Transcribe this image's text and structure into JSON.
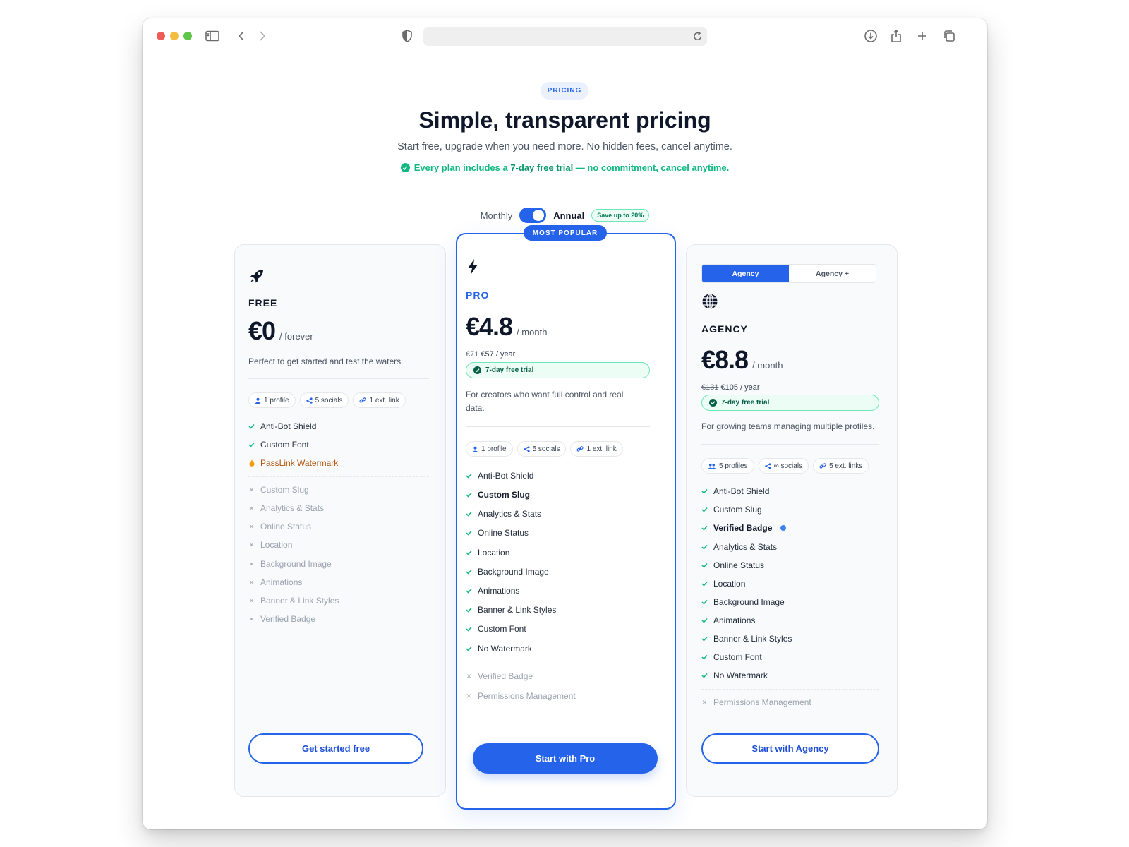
{
  "browser": {
    "address_value": ""
  },
  "header": {
    "eyebrow": "PRICING",
    "title": "Simple, transparent pricing",
    "subtitle": "Start free, upgrade when you need more. No hidden fees, cancel anytime.",
    "trial_prefix": "Every plan includes a ",
    "trial_strong": "7-day free trial",
    "trial_suffix": " — no commitment, cancel anytime."
  },
  "billing": {
    "monthly_label": "Monthly",
    "annual_label": "Annual",
    "save_badge": "Save up to 20%",
    "annual_selected": true
  },
  "plans": {
    "free": {
      "icon": "rocket-icon",
      "name": "FREE",
      "price": "€0",
      "period": "/ forever",
      "description": "Perfect to get started and test the waters.",
      "chips": [
        "1 profile",
        "5 socials",
        "1 ext. link"
      ],
      "included": [
        "Anti-Bot Shield",
        "Custom Font"
      ],
      "warning": "PassLink Watermark",
      "excluded": [
        "Custom Slug",
        "Analytics & Stats",
        "Online Status",
        "Location",
        "Background Image",
        "Animations",
        "Banner & Link Styles",
        "Verified Badge"
      ],
      "cta": "Get started free"
    },
    "pro": {
      "badge": "MOST POPULAR",
      "icon": "lightning-icon",
      "name": "PRO",
      "price": "€4.8",
      "period": "/ month",
      "old_yearly": "€71",
      "yearly": "€57 / year",
      "trial": "7-day free trial",
      "description": "For creators who want full control and real data.",
      "chips": [
        "1 profile",
        "5 socials",
        "1 ext. link"
      ],
      "included": [
        "Anti-Bot Shield",
        "Custom Slug",
        "Analytics & Stats",
        "Online Status",
        "Location",
        "Background Image",
        "Animations",
        "Banner & Link Styles",
        "Custom Font",
        "No Watermark"
      ],
      "excluded": [
        "Verified Badge",
        "Permissions Management"
      ],
      "cta": "Start with Pro"
    },
    "agency": {
      "tabs": [
        "Agency",
        "Agency +"
      ],
      "icon": "globe-icon",
      "name": "AGENCY",
      "price": "€8.8",
      "period": "/ month",
      "old_yearly": "€131",
      "yearly": "€105 / year",
      "trial": "7-day free trial",
      "description": "For growing teams managing multiple profiles.",
      "chips": [
        "5 profiles",
        "∞ socials",
        "5 ext. links"
      ],
      "included": [
        "Anti-Bot Shield",
        "Custom Slug",
        "Verified Badge",
        "Analytics & Stats",
        "Online Status",
        "Location",
        "Background Image",
        "Animations",
        "Banner & Link Styles",
        "Custom Font",
        "No Watermark"
      ],
      "excluded": [
        "Permissions Management"
      ],
      "cta": "Start with Agency"
    }
  },
  "colors": {
    "accent": "#2563eb",
    "success": "#10b981",
    "warning": "#b45309"
  }
}
